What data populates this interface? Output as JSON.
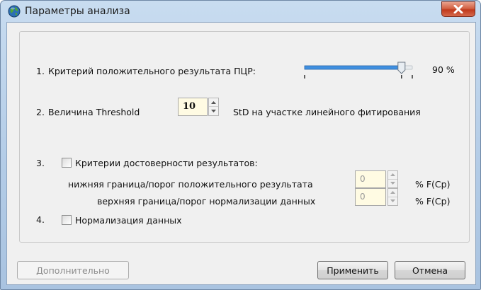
{
  "window": {
    "title": "Параметры анализа",
    "close_glyph": "✕"
  },
  "item1": {
    "number": "1.",
    "label": "Критерий положительного результата ПЦР:",
    "percent_value": 90,
    "percent_label": "90 %"
  },
  "item2": {
    "number": "2.",
    "label": "Величина Threshold",
    "value": "10",
    "suffix": "StD на участке линейного фитирования"
  },
  "item3": {
    "number": "3.",
    "label": "Критерии достоверности результатов:",
    "checked": false,
    "lower_label": "нижняя граница/порог положительного результата",
    "lower_value": "0",
    "lower_unit": "% F(Cp)",
    "upper_label": "верхняя граница/порог нормализации данных",
    "upper_value": "0",
    "upper_unit": "% F(Cp)"
  },
  "item4": {
    "number": "4.",
    "label": "Нормализация данных",
    "checked": false
  },
  "buttons": {
    "advanced": "Дополнительно",
    "apply": "Применить",
    "cancel": "Отмена"
  },
  "icons": {
    "app": "globe-icon",
    "close": "close-icon",
    "spin_up": "up-arrow-icon",
    "spin_down": "down-arrow-icon"
  },
  "colors": {
    "accent": "#3f8fe0",
    "field_bg": "#fffbe3"
  }
}
